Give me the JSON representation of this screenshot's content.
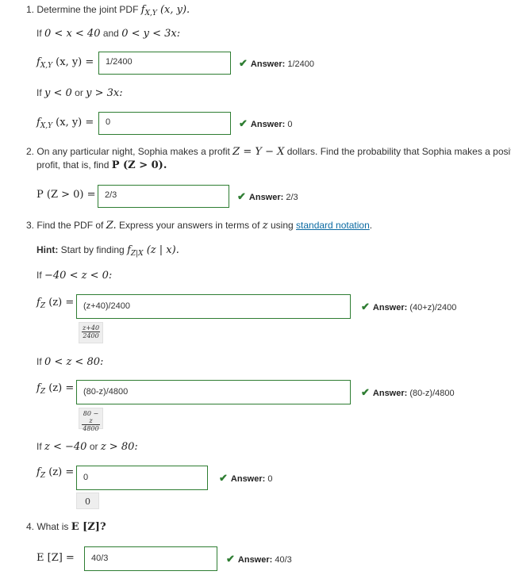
{
  "q1": {
    "number": "1.",
    "text": "Determine the joint PDF",
    "func": "f",
    "func_sub": "X,Y",
    "func_args": "(x, y).",
    "cond1": {
      "prefix": "If",
      "math": "0 < x < 40",
      "mid": "and",
      "math2": "0 < y < 3x:"
    },
    "row1": {
      "lhs": "f",
      "lhs_sub": "X,Y",
      "lhs_args": "(x, y) =",
      "value": "1/2400",
      "answer_label": "Answer:",
      "answer_value": "1/2400"
    },
    "cond2": {
      "prefix": "If",
      "math": "y < 0",
      "mid": "or",
      "math2": "y > 3x:"
    },
    "row2": {
      "lhs": "f",
      "lhs_sub": "X,Y",
      "lhs_args": "(x, y) =",
      "value": "0",
      "answer_label": "Answer:",
      "answer_value": "0"
    }
  },
  "q2": {
    "number": "2.",
    "line1a": "On any particular night, Sophia makes a profit",
    "line1math": "Z = Y − X",
    "line1b": "dollars. Find the probability that Sophia makes a positive",
    "line2a": "profit, that is, find",
    "line2math": "P (Z > 0).",
    "lhs": "P (Z > 0) =",
    "value": "2/3",
    "answer_label": "Answer:",
    "answer_value": "2/3"
  },
  "q3": {
    "number": "3.",
    "text_a": "Find the PDF of",
    "text_math": "Z.",
    "text_b": "Express your answers in terms of",
    "text_math2": "z",
    "text_c": "using",
    "link": "standard notation",
    "text_d": ".",
    "hint_label": "Hint:",
    "hint_text": "Start by finding",
    "hint_math": "f",
    "hint_sub": "Z|X",
    "hint_args": "(z | x).",
    "case1": {
      "cond_prefix": "If",
      "cond_math": "−40 < z < 0:",
      "lhs": "f",
      "lhs_sub": "Z",
      "lhs_args": "(z) =",
      "value": "(z+40)/2400",
      "preview_num": "z+40",
      "preview_den": "2400",
      "answer_label": "Answer:",
      "answer_value": "(40+z)/2400"
    },
    "case2": {
      "cond_prefix": "If",
      "cond_math": "0 < z < 80:",
      "lhs": "f",
      "lhs_sub": "Z",
      "lhs_args": "(z) =",
      "value": "(80-z)/4800",
      "preview_num": "80 − z",
      "preview_den": "4800",
      "answer_label": "Answer:",
      "answer_value": "(80-z)/4800"
    },
    "case3": {
      "cond_prefix": "If",
      "cond_math": "z < −40",
      "cond_mid": "or",
      "cond_math2": "z > 80:",
      "lhs": "f",
      "lhs_sub": "Z",
      "lhs_args": "(z) =",
      "value": "0",
      "preview": "0",
      "answer_label": "Answer:",
      "answer_value": "0"
    }
  },
  "q4": {
    "number": "4.",
    "text": "What is",
    "math": "E [Z]?",
    "lhs": "E [Z] =",
    "value": "40/3",
    "answer_label": "Answer:",
    "answer_value": "40/3"
  },
  "colors": {
    "correct": "#2e7d32",
    "link": "#0b6aa2"
  },
  "icons": {
    "answer": "checkmark-icon"
  }
}
